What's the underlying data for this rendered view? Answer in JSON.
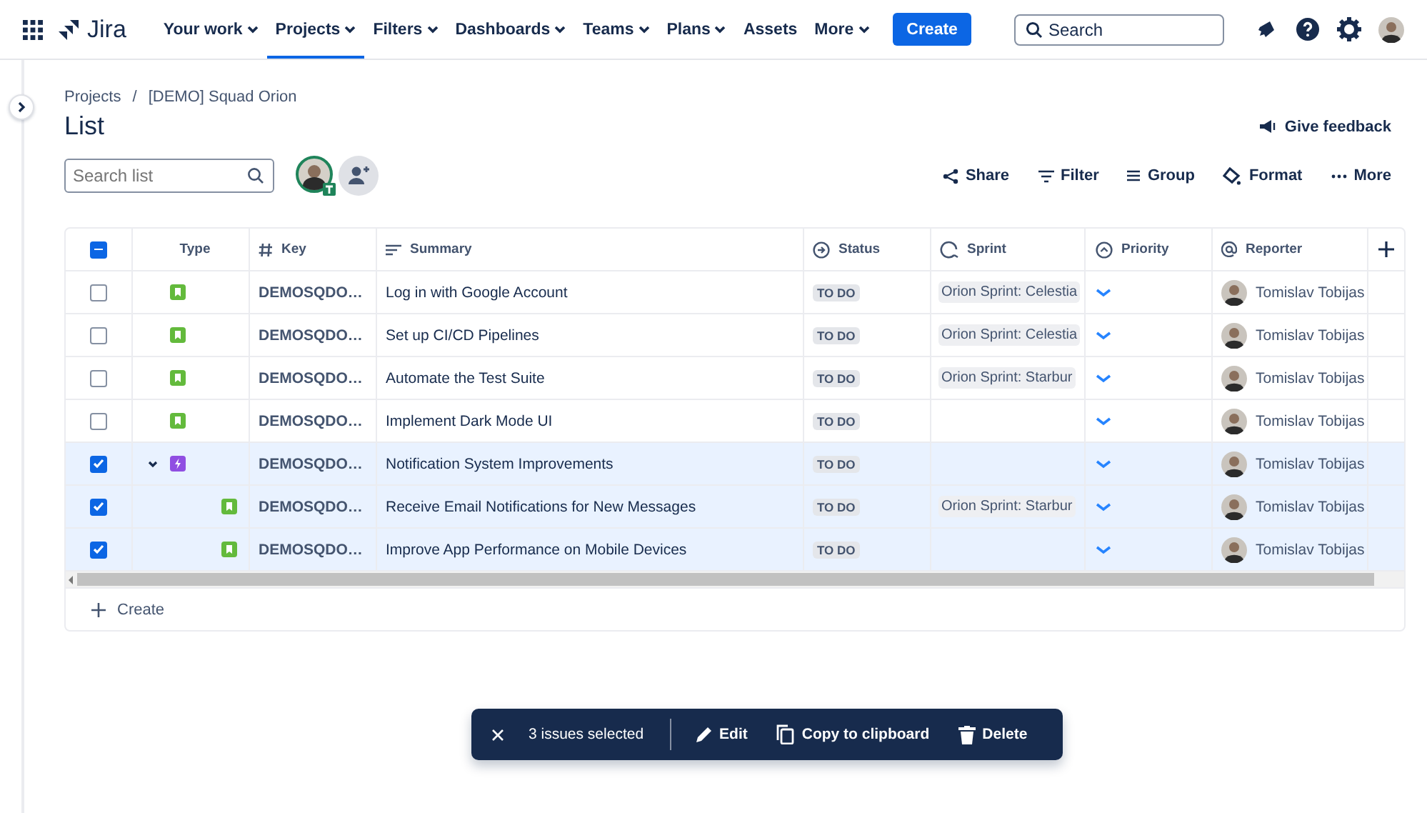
{
  "nav": {
    "product": "Jira",
    "items": [
      {
        "label": "Your work",
        "dropdown": true,
        "selected": false
      },
      {
        "label": "Projects",
        "dropdown": true,
        "selected": true
      },
      {
        "label": "Filters",
        "dropdown": true,
        "selected": false
      },
      {
        "label": "Dashboards",
        "dropdown": true,
        "selected": false
      },
      {
        "label": "Teams",
        "dropdown": true,
        "selected": false
      },
      {
        "label": "Plans",
        "dropdown": true,
        "selected": false
      },
      {
        "label": "Assets",
        "dropdown": false,
        "selected": false
      },
      {
        "label": "More",
        "dropdown": true,
        "selected": false
      }
    ],
    "create": "Create",
    "search": {
      "placeholder": "Search"
    }
  },
  "breadcrumbs": [
    "Projects",
    "[DEMO] Squad Orion"
  ],
  "breadcrumb_separator": "/",
  "title": "List",
  "feedback": "Give feedback",
  "search_list": {
    "placeholder": "Search list"
  },
  "toolbar": [
    "Share",
    "Filter",
    "Group",
    "Format",
    "More"
  ],
  "table": {
    "header_checkbox": {
      "indeterminate": true
    },
    "columns": [
      "Type",
      "Key",
      "Summary",
      "Status",
      "Sprint",
      "Priority",
      "Reporter"
    ],
    "rows": [
      {
        "kind": "story",
        "key": "DEMOSQDO…",
        "summary": "Log in with Google Account",
        "status": "TO DO",
        "sprint": "Orion Sprint: Celestia",
        "reporter": "Tomislav Tobijas",
        "selected": false
      },
      {
        "kind": "story",
        "key": "DEMOSQDO…",
        "summary": "Set up CI/CD Pipelines",
        "status": "TO DO",
        "sprint": "Orion Sprint: Celestia",
        "reporter": "Tomislav Tobijas",
        "selected": false
      },
      {
        "kind": "story",
        "key": "DEMOSQDO…",
        "summary": "Automate the Test Suite",
        "status": "TO DO",
        "sprint": "Orion Sprint: Starbur",
        "reporter": "Tomislav Tobijas",
        "selected": false
      },
      {
        "kind": "story",
        "key": "DEMOSQDO…",
        "summary": "Implement Dark Mode UI",
        "status": "TO DO",
        "reporter": "Tomislav Tobijas",
        "selected": false
      },
      {
        "kind": "epic",
        "key": "DEMOSQDO…",
        "summary": "Notification System Improvements",
        "status": "TO DO",
        "reporter": "Tomislav Tobijas",
        "selected": true,
        "expanded": true,
        "children": [
          {
            "kind": "story",
            "key": "DEMOSQDO…",
            "summary": "Receive Email Notifications for New Messages",
            "status": "TO DO",
            "sprint": "Orion Sprint: Starbur",
            "reporter": "Tomislav Tobijas",
            "selected": true
          },
          {
            "kind": "story",
            "key": "DEMOSQDO…",
            "summary": "Improve App Performance on Mobile Devices",
            "status": "TO DO",
            "reporter": "Tomislav Tobijas",
            "selected": true
          }
        ]
      }
    ],
    "create": "Create"
  },
  "selection_bar": {
    "count": "3 issues selected",
    "actions": [
      "Edit",
      "Copy to clipboard",
      "Delete"
    ]
  }
}
